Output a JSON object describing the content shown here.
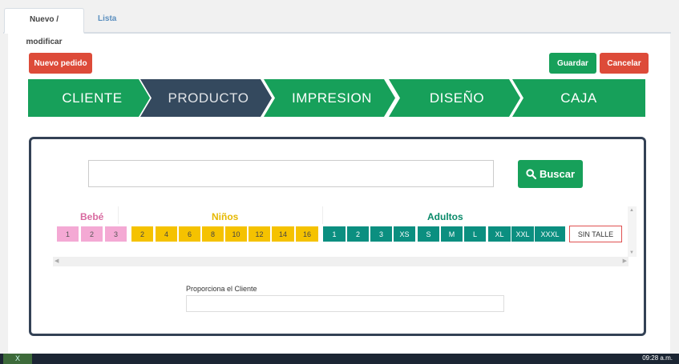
{
  "tabs": [
    {
      "label": "Nuevo / modificar",
      "active": true
    },
    {
      "label": "Lista",
      "active": false
    }
  ],
  "toolbar": {
    "new_order": "Nuevo pedido",
    "save": "Guardar",
    "cancel": "Cancelar"
  },
  "steps": [
    {
      "label": "CLIENTE",
      "active": false
    },
    {
      "label": "PRODUCTO",
      "active": true
    },
    {
      "label": "IMPRESION",
      "active": false
    },
    {
      "label": "DISEÑO",
      "active": false
    },
    {
      "label": "CAJA",
      "active": false
    }
  ],
  "search": {
    "value": "",
    "button_label": "Buscar",
    "button_icon": "search-icon"
  },
  "sizes": {
    "groups": [
      {
        "name": "Bebé",
        "color": "#d86aa0",
        "items": [
          "1",
          "2",
          "3"
        ]
      },
      {
        "name": "Niños",
        "color": "#e6b800",
        "items": [
          "2",
          "4",
          "6",
          "8",
          "10",
          "12",
          "14",
          "16"
        ]
      },
      {
        "name": "Adultos",
        "color": "#0a8a6a",
        "items": [
          "1",
          "2",
          "3",
          "XS",
          "S",
          "M",
          "L",
          "XL",
          "XXL",
          "XXXL"
        ]
      }
    ],
    "no_size": "SIN TALLE"
  },
  "client_field": {
    "label": "Proporciona el Cliente",
    "value": ""
  },
  "taskbar": {
    "clock": "09:28 a.m."
  },
  "colors": {
    "green": "#17a05a",
    "red": "#dd4b39",
    "active_step": "#34495e",
    "pink": "#f4a9d4",
    "yellow": "#f5c200",
    "teal": "#0b8f80"
  }
}
